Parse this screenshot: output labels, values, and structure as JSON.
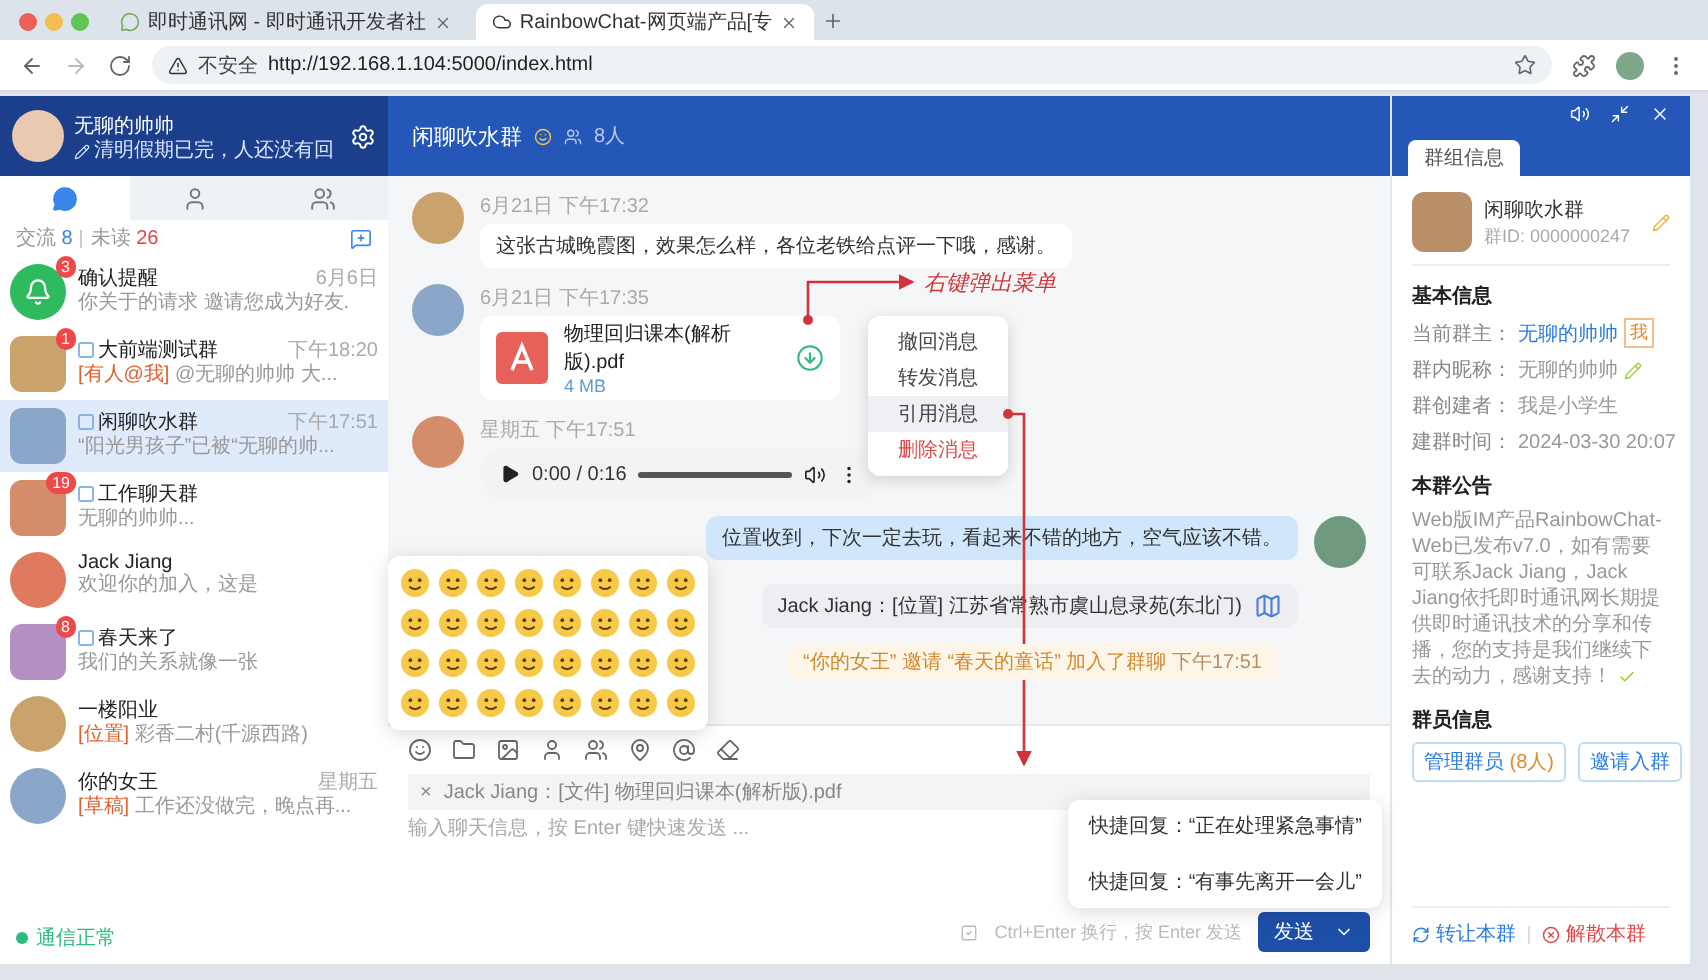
{
  "browser": {
    "tabs": [
      {
        "title": "即时通讯网 - 即时通讯开发者社",
        "selected": false
      },
      {
        "title": "RainbowChat-网页端产品[专",
        "selected": true
      }
    ],
    "security": "不安全",
    "url": "http://192.168.1.104:5000/index.html"
  },
  "profile": {
    "name": "无聊的帅帅",
    "status": "清明假期已完，人还没有回"
  },
  "sidebar": {
    "tabs": [
      {
        "kind": "chat",
        "selected": true
      },
      {
        "kind": "contacts",
        "selected": false
      },
      {
        "kind": "groups",
        "selected": false
      }
    ],
    "summary": {
      "label1": "交流",
      "count1": "8",
      "label2": "未读",
      "count2": "26"
    },
    "conversations": [
      {
        "kind": "notice",
        "name": "确认提醒",
        "time": "6月6日",
        "preview": "你关于的请求 邀请您成为好友.",
        "badge": "3",
        "selected": false
      },
      {
        "kind": "group",
        "name": "大前端测试群",
        "time": "下午18:20",
        "tag": "[有人@我]",
        "preview": "@无聊的帅帅 大...",
        "badge": "1",
        "selected": false
      },
      {
        "kind": "group",
        "name": "闲聊吹水群",
        "time": "下午17:51",
        "preview": "“阳光男孩子”已被“无聊的帅...",
        "selected": true
      },
      {
        "kind": "group",
        "name": "工作聊天群",
        "preview": "无聊的帅帅...",
        "badge": "19",
        "selected": false
      },
      {
        "kind": "person",
        "name": "Jack Jiang",
        "preview": "欢迎你的加入，这是",
        "selected": false
      },
      {
        "kind": "group",
        "name": "春天来了",
        "preview": "我们的关系就像一张",
        "badge": "8",
        "selected": false
      },
      {
        "kind": "person",
        "name": "一楼阳业",
        "tag": "[位置]",
        "preview": "彩香二村(千源西路)",
        "selected": false
      },
      {
        "kind": "person",
        "name": "你的女王",
        "time": "星期五",
        "tag": "[草稿]",
        "preview": "工作还没做完，晚点再...",
        "selected": false
      }
    ],
    "status": "通信正常"
  },
  "chat": {
    "title": "闲聊吹水群",
    "members": "8人",
    "messages": [
      {
        "kind": "text",
        "outgoing": false,
        "time": "6月21日 下午17:32",
        "text": "这张古城晚霞图，效果怎么样，各位老铁给点评一下哦，感谢。"
      },
      {
        "kind": "file",
        "outgoing": false,
        "time": "6月21日 下午17:35",
        "file_name": "物理回归课本(解析版).pdf",
        "size": "4 MB"
      },
      {
        "kind": "audio",
        "outgoing": false,
        "time": "星期五 下午17:51",
        "duration": "0:00 / 0:16"
      },
      {
        "kind": "text",
        "outgoing": true,
        "text": "位置收到，下次一定去玩，看起来不错的地方，空气应该不错。"
      },
      {
        "kind": "location",
        "outgoing": true,
        "text": "Jack Jiang：[位置] 江苏省常熟市虞山息录苑(东北门)"
      },
      {
        "kind": "system",
        "text": "“你的女王” 邀请 “春天的童话” 加入了群聊",
        "time": "下午17:51"
      }
    ],
    "context_menu": [
      {
        "label": "撤回消息",
        "danger": false,
        "selected": false
      },
      {
        "label": "转发消息",
        "danger": false,
        "selected": false
      },
      {
        "label": "引用消息",
        "danger": false,
        "selected": true
      },
      {
        "label": "删除消息",
        "danger": true,
        "selected": false
      }
    ],
    "annotation": "右键弹出菜单",
    "composer": {
      "quote_close": "×",
      "quote": "Jack Jiang：[文件] 物理回归课本(解析版).pdf",
      "placeholder": "输入聊天信息，按 Enter 键快速发送 ...",
      "hint": "Ctrl+Enter 换行，按 Enter 发送",
      "send": "发送"
    },
    "quick_replies": [
      "快捷回复：“正在处理紧急事情”",
      "快捷回复：“有事先离开一会儿”"
    ]
  },
  "right_panel": {
    "tab": "群组信息",
    "group_name": "闲聊吹水群",
    "group_id": "群ID: 0000000247",
    "basic_title": "基本信息",
    "fields": [
      {
        "kind": "owner",
        "label": "当前群主：",
        "value": "无聊的帅帅",
        "tag": "我"
      },
      {
        "kind": "editable",
        "label": "群内昵称：",
        "value": "无聊的帅帅"
      },
      {
        "kind": "plain",
        "label": "群创建者：",
        "value": "我是小学生"
      },
      {
        "kind": "plain",
        "label": "建群时间：",
        "value": "2024-03-30 20:07"
      }
    ],
    "notice_title": "本群公告",
    "notice": "Web版IM产品RainbowChat-Web已发布v7.0，如有需要可联系Jack Jiang，Jack Jiang依托即时通讯网长期提供即时通讯技术的分享和传播，您的支持是我们继续下去的动力，感谢支持！",
    "members_title": "群员信息",
    "member_buttons": [
      {
        "label": "管理群员",
        "count": "(8人)"
      },
      {
        "label": "邀请入群"
      }
    ],
    "actions": [
      {
        "kind": "transfer",
        "label": "转让本群"
      },
      {
        "kind": "dissolve",
        "label": "解散本群"
      }
    ]
  }
}
